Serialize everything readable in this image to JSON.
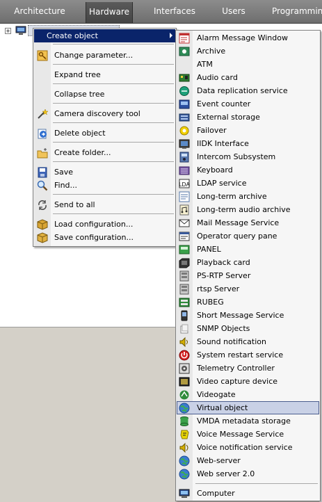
{
  "tabs": [
    {
      "label": "Architecture"
    },
    {
      "label": "Hardware"
    },
    {
      "label": "Interfaces"
    },
    {
      "label": "Users"
    },
    {
      "label": "Programming"
    }
  ],
  "active_tab": "Hardware",
  "tree": {
    "expander": "+"
  },
  "context_menu": {
    "items": [
      {
        "label": "Create object",
        "icon": "none",
        "submenu": true
      },
      {
        "label": "Change parameter...",
        "icon": "key-icon"
      },
      {
        "label": "Expand tree",
        "icon": "none"
      },
      {
        "label": "Collapse tree",
        "icon": "none"
      },
      {
        "label": "Camera discovery tool",
        "icon": "wand-icon"
      },
      {
        "label": "Delete object",
        "icon": "delete-icon"
      },
      {
        "label": "Create folder...",
        "icon": "new-folder-icon"
      },
      {
        "label": "Save",
        "icon": "save-icon"
      },
      {
        "label": "Find...",
        "icon": "magnifier-icon"
      },
      {
        "label": "Send to all",
        "icon": "refresh-icon"
      },
      {
        "label": "Load configuration...",
        "icon": "load-config-icon"
      },
      {
        "label": "Save configuration...",
        "icon": "save-config-icon"
      }
    ]
  },
  "submenu": {
    "items": [
      {
        "label": "Alarm Message Window",
        "icon": "alarm-window-icon"
      },
      {
        "label": "Archive",
        "icon": "archive-icon"
      },
      {
        "label": "ATM",
        "icon": "none"
      },
      {
        "label": "Audio card",
        "icon": "audio-card-icon"
      },
      {
        "label": "Data replication service",
        "icon": "replication-icon"
      },
      {
        "label": "Event counter",
        "icon": "event-counter-icon"
      },
      {
        "label": "External storage",
        "icon": "storage-icon"
      },
      {
        "label": "Failover",
        "icon": "failover-icon"
      },
      {
        "label": "IIDK Interface",
        "icon": "iidk-icon"
      },
      {
        "label": "Intercom Subsystem",
        "icon": "intercom-icon"
      },
      {
        "label": "Keyboard",
        "icon": "keyboard-icon"
      },
      {
        "label": "LDAP service",
        "icon": "ldap-icon"
      },
      {
        "label": "Long-term archive",
        "icon": "long-term-archive-icon"
      },
      {
        "label": "Long-term audio archive",
        "icon": "audio-archive-icon"
      },
      {
        "label": "Mail Message Service",
        "icon": "mail-icon"
      },
      {
        "label": "Operator query pane",
        "icon": "query-pane-icon"
      },
      {
        "label": "PANEL",
        "icon": "panel-icon"
      },
      {
        "label": "Playback card",
        "icon": "playback-card-icon"
      },
      {
        "label": "PS-RTP Server",
        "icon": "server-icon"
      },
      {
        "label": "rtsp Server",
        "icon": "server-icon"
      },
      {
        "label": "RUBEG",
        "icon": "rubeg-icon"
      },
      {
        "label": "Short Message Service",
        "icon": "sms-icon"
      },
      {
        "label": "SNMP Objects",
        "icon": "snmp-icon"
      },
      {
        "label": "Sound notification",
        "icon": "sound-icon"
      },
      {
        "label": "System restart service",
        "icon": "power-icon"
      },
      {
        "label": "Telemetry Controller",
        "icon": "telemetry-icon"
      },
      {
        "label": "Video capture device",
        "icon": "capture-device-icon"
      },
      {
        "label": "Videogate",
        "icon": "videogate-icon"
      },
      {
        "label": "Virtual object",
        "icon": "globe-icon",
        "highlighted": true
      },
      {
        "label": "VMDA metadata storage",
        "icon": "database-icon"
      },
      {
        "label": "Voice Message Service",
        "icon": "voice-message-icon"
      },
      {
        "label": "Voice notification service",
        "icon": "speaker-icon"
      },
      {
        "label": "Web-server",
        "icon": "globe-icon"
      },
      {
        "label": "Web server 2.0",
        "icon": "globe-icon"
      },
      {
        "label": "Computer",
        "icon": "computer-icon"
      }
    ]
  }
}
